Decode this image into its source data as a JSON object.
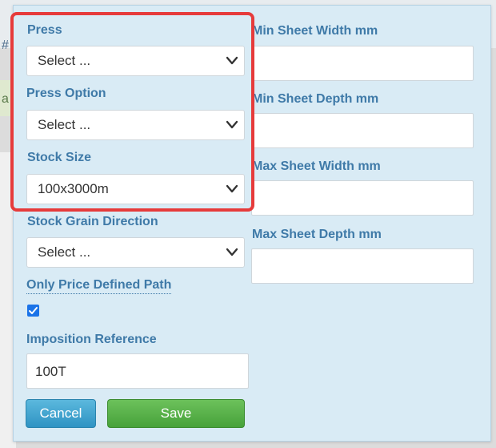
{
  "form": {
    "press": {
      "label": "Press",
      "value": "Select ..."
    },
    "press_option": {
      "label": "Press Option",
      "value": "Select ..."
    },
    "stock_size": {
      "label": "Stock Size",
      "value": "100x3000m"
    },
    "stock_grain_direction": {
      "label": "Stock Grain Direction",
      "value": "Select ..."
    },
    "only_price_defined_path": {
      "label": "Only Price Defined Path",
      "checked": true
    },
    "imposition_reference": {
      "label": "Imposition Reference",
      "value": "100T"
    },
    "min_sheet_width": {
      "label": "Min Sheet Width mm",
      "value": ""
    },
    "min_sheet_depth": {
      "label": "Min Sheet Depth mm",
      "value": ""
    },
    "max_sheet_width": {
      "label": "Max Sheet Width mm",
      "value": ""
    },
    "max_sheet_depth": {
      "label": "Max Sheet Depth mm",
      "value": ""
    }
  },
  "buttons": {
    "cancel": "Cancel",
    "save": "Save"
  },
  "background": {
    "glyph_top": "#",
    "glyph_mid": "a"
  },
  "colors": {
    "label": "#3f7aa8",
    "highlight": "#e63b3b",
    "cancel": "#2f93c3",
    "save": "#47a23a",
    "panel": "#d9ebf5"
  },
  "icons": {
    "dropdown": "chevron-down-icon",
    "checkbox": "checkmark-icon"
  }
}
